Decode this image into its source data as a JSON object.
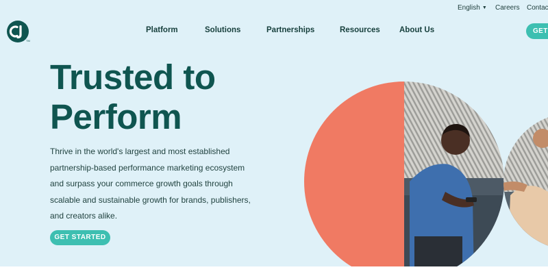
{
  "utility": {
    "language": "English",
    "careers": "Careers",
    "contact": "Contac"
  },
  "nav": {
    "items": [
      "Platform",
      "Solutions",
      "Partnerships",
      "Resources",
      "About Us"
    ],
    "cta": "GET"
  },
  "hero": {
    "headline_line1": "Trusted to",
    "headline_line2": "Perform",
    "description": "Thrive in the world's largest and most established partnership-based performance marketing ecosystem and surpass your commerce growth goals through scalable and sustainable growth for brands, publishers, and creators alike.",
    "cta": "GET STARTED"
  },
  "colors": {
    "background": "#dff1f8",
    "brand_dark": "#0f5550",
    "accent_teal": "#3dbfb1",
    "coral": "#f07a63"
  },
  "icons": {
    "logo": "cj-logo-icon",
    "language_dropdown": "caret-down-icon"
  }
}
